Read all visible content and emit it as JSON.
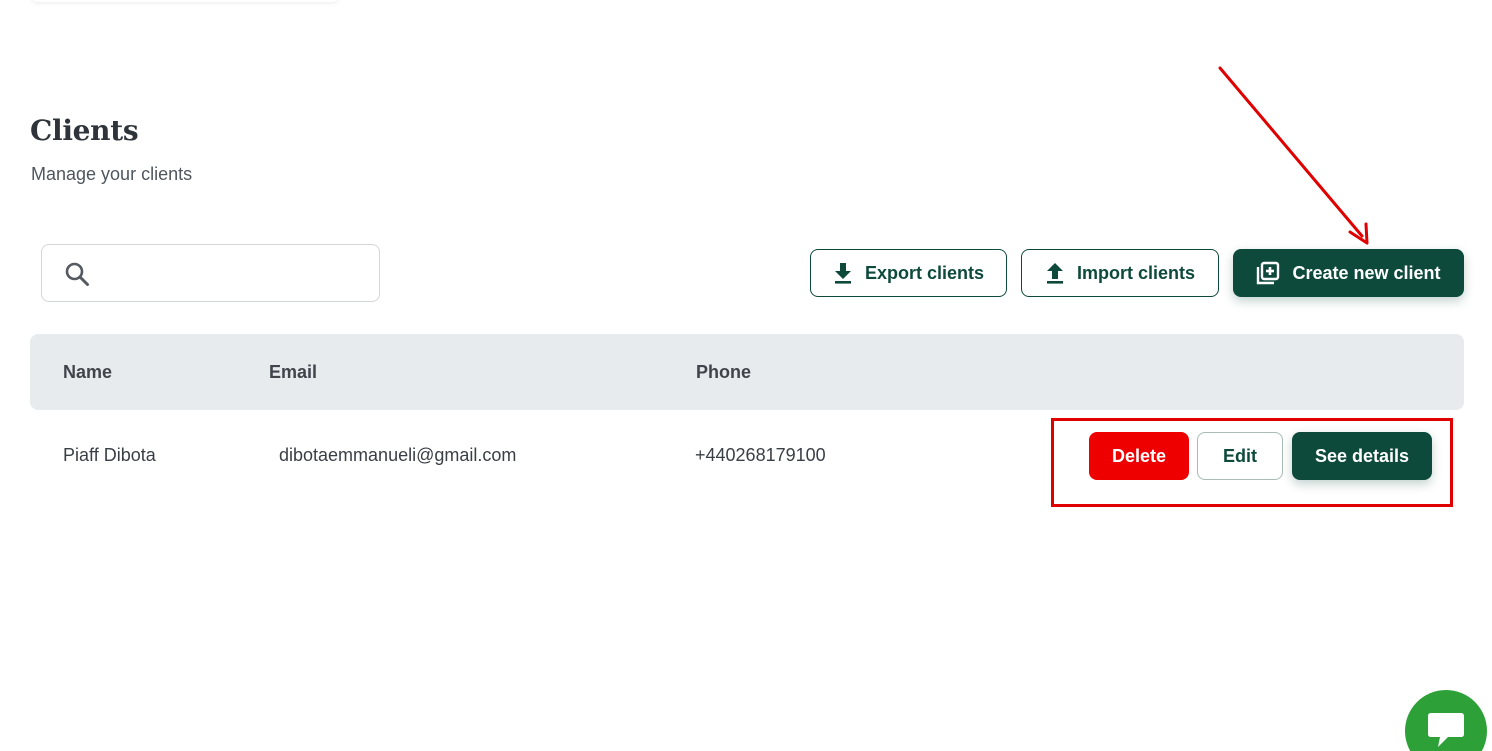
{
  "header": {
    "title": "Clients",
    "subtitle": "Manage your clients"
  },
  "search": {
    "value": "",
    "icon": "search-icon"
  },
  "toolbar": {
    "export_label": "Export clients",
    "export_icon": "download-icon",
    "import_label": "Import clients",
    "import_icon": "upload-icon",
    "create_label": "Create new client",
    "create_icon": "add-box-icon"
  },
  "table": {
    "columns": [
      "Name",
      "Email",
      "Phone"
    ],
    "rows": [
      {
        "name": "Piaff Dibota",
        "email": "dibotaemmanueli@gmail.com",
        "phone": "+440268179100",
        "actions": {
          "delete_label": "Delete",
          "edit_label": "Edit",
          "details_label": "See details"
        }
      }
    ]
  },
  "chat_widget": {
    "icon": "chat-icon"
  },
  "colors": {
    "primary": "#0d4a3c",
    "danger": "#ee0000",
    "header_bg": "#e8ebee",
    "chat": "#2da038",
    "annotation": "#e00000"
  }
}
